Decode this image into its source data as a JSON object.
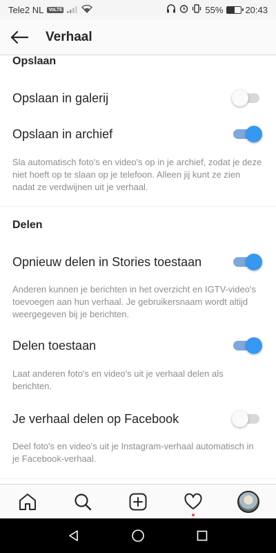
{
  "status_bar": {
    "carrier": "Tele2 NL",
    "volte": "VoLTE",
    "battery_percent": "55%",
    "battery_level": 0.55,
    "time": "20:43"
  },
  "header": {
    "title": "Verhaal",
    "back_icon": "arrow-left-icon"
  },
  "sections": {
    "save": {
      "heading": "Opslaan",
      "gallery_label": "Opslaan in galerij",
      "gallery_on": false,
      "archive_label": "Opslaan in archief",
      "archive_on": true,
      "archive_desc": "Sla automatisch foto's en video's op in je archief, zodat je deze niet hoeft op te slaan op je telefoon. Alleen jij kunt ze zien nadat ze verdwijnen uit je verhaal."
    },
    "share": {
      "heading": "Delen",
      "reshare_label": "Opnieuw delen in Stories toestaan",
      "reshare_on": true,
      "reshare_desc": "Anderen kunnen je berichten in het overzicht en IGTV-video's toevoegen aan hun verhaal. Je gebruikersnaam wordt altijd weergegeven bij je berichten.",
      "sharing_label": "Delen toestaan",
      "sharing_on": true,
      "sharing_desc": "Laat anderen foto's en video's uit je verhaal delen als berichten.",
      "facebook_label": "Je verhaal delen op Facebook",
      "facebook_on": false,
      "facebook_desc": "Deel foto's en video's uit je Instagram-verhaal automatisch in je Facebook-verhaal."
    }
  },
  "bottom_nav": {
    "items": [
      "home-icon",
      "search-icon",
      "new-post-icon",
      "activity-heart-icon",
      "profile-avatar"
    ],
    "activity_badge": true
  },
  "system_nav": [
    "back-triangle-icon",
    "home-circle-icon",
    "recents-square-icon"
  ],
  "colors": {
    "toggle_on_knob": "#3897f0",
    "toggle_on_track": "#7ea7db",
    "toggle_off_track": "#d8d8d8",
    "notification_dot": "#ed4956"
  }
}
